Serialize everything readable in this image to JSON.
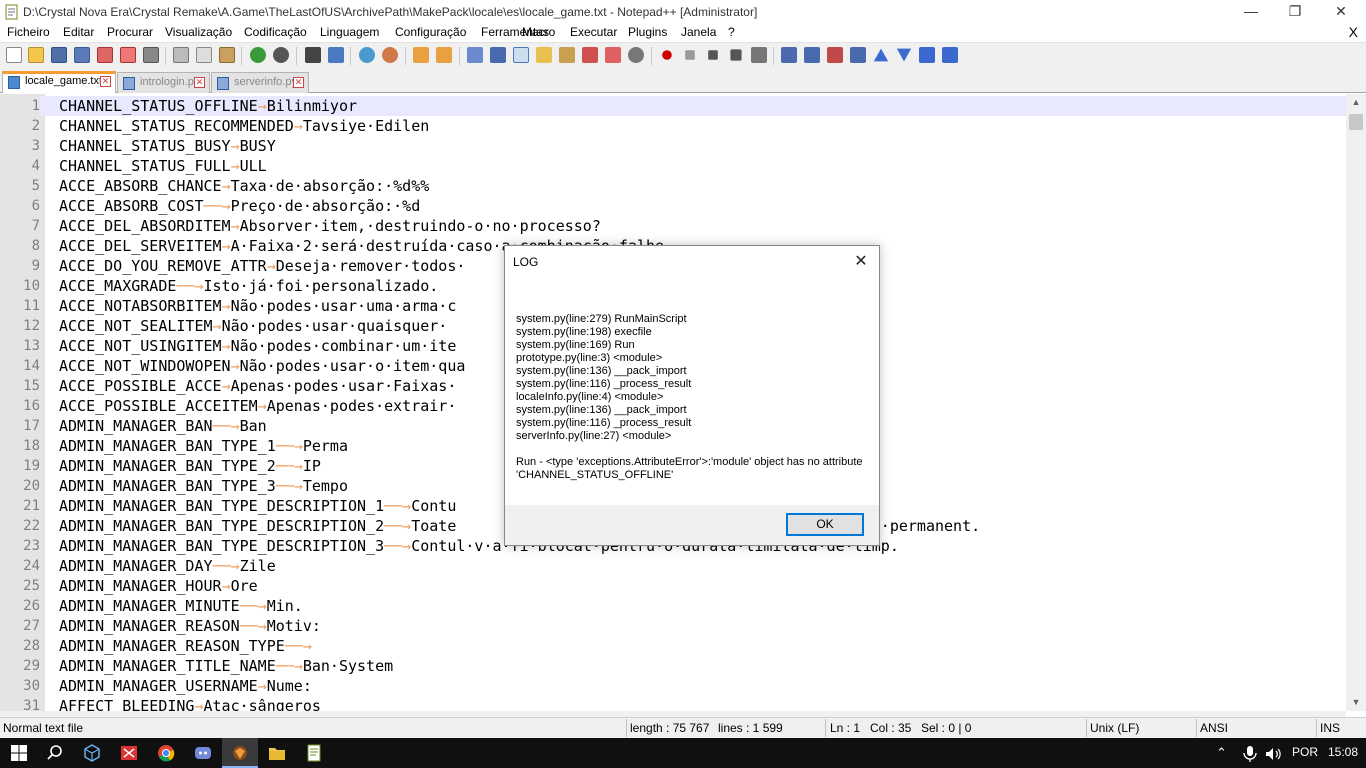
{
  "window": {
    "title": "D:\\Crystal Nova Era\\Crystal Remake\\A.Game\\TheLastOfUS\\ArchivePath\\MakePack\\locale\\es\\locale_game.txt - Notepad++ [Administrator]",
    "minimize": "—",
    "restore": "❐",
    "close": "✕"
  },
  "menu": {
    "items": [
      "Ficheiro",
      "Editar",
      "Procurar",
      "Visualização",
      "Codificação",
      "Linguagem",
      "Configuração",
      "Ferramentas",
      "Macro",
      "Executar",
      "Plugins",
      "Janela",
      "?"
    ],
    "close_doc": "X"
  },
  "tabs": [
    {
      "label": "locale_game.txt",
      "active": true
    },
    {
      "label": "intrologin.py",
      "active": false
    },
    {
      "label": "serverinfo.py",
      "active": false
    }
  ],
  "tab_close_glyph": "✕",
  "editor": {
    "tab_arrow": "→",
    "lines": [
      {
        "n": "1",
        "key": "CHANNEL_STATUS_OFFLINE",
        "pad": "",
        "val": "Bilinmiyor"
      },
      {
        "n": "2",
        "key": "CHANNEL_STATUS_RECOMMENDED",
        "pad": "",
        "val": "Tavsiye·Edilen"
      },
      {
        "n": "3",
        "key": "CHANNEL_STATUS_BUSY",
        "pad": "",
        "val": "BUSY"
      },
      {
        "n": "4",
        "key": "CHANNEL_STATUS_FULL",
        "pad": "",
        "val": "ULL"
      },
      {
        "n": "5",
        "key": "ACCE_ABSORB_CHANCE",
        "pad": "",
        "val": "Taxa·de·absorção:·%d%%"
      },
      {
        "n": "6",
        "key": "ACCE_ABSORB_COST",
        "pad": "──",
        "val": "Preço·de·absorção:·%d"
      },
      {
        "n": "7",
        "key": "ACCE_DEL_ABSORDITEM",
        "pad": "",
        "val": "Absorver·item,·destruindo-o·no·processo?"
      },
      {
        "n": "8",
        "key": "ACCE_DEL_SERVEITEM",
        "pad": "",
        "val": "A·Faixa·2·será·destruída·caso·a·combinação·falhe."
      },
      {
        "n": "9",
        "key": "ACCE_DO_YOU_REMOVE_ATTR",
        "pad": "",
        "val": "Deseja·remover·todos·"
      },
      {
        "n": "10",
        "key": "ACCE_MAXGRADE",
        "pad": "──",
        "val": "Isto·já·foi·personalizado."
      },
      {
        "n": "11",
        "key": "ACCE_NOTABSORBITEM",
        "pad": "",
        "val": "Não·podes·usar·uma·arma·c                                    a."
      },
      {
        "n": "12",
        "key": "ACCE_NOT_SEALITEM",
        "pad": "",
        "val": "Não·podes·usar·quaisquer·"
      },
      {
        "n": "13",
        "key": "ACCE_NOT_USINGITEM",
        "pad": "",
        "val": "Não·podes·combinar·um·ite"
      },
      {
        "n": "14",
        "key": "ACCE_NOT_WINDOWOPEN",
        "pad": "",
        "val": "Não·podes·usar·o·item·qua                                    a."
      },
      {
        "n": "15",
        "key": "ACCE_POSSIBLE_ACCE",
        "pad": "",
        "val": "Apenas·podes·usar·Faixas·"
      },
      {
        "n": "16",
        "key": "ACCE_POSSIBLE_ACCEITEM",
        "pad": "",
        "val": "Apenas·podes·extrair·"
      },
      {
        "n": "17",
        "key": "ADMIN_MANAGER_BAN",
        "pad": "──",
        "val": "Ban"
      },
      {
        "n": "18",
        "key": "ADMIN_MANAGER_BAN_TYPE_1",
        "pad": "──",
        "val": "Perma"
      },
      {
        "n": "19",
        "key": "ADMIN_MANAGER_BAN_TYPE_2",
        "pad": "──",
        "val": "IP"
      },
      {
        "n": "20",
        "key": "ADMIN_MANAGER_BAN_TYPE_3",
        "pad": "──",
        "val": "Tempo"
      },
      {
        "n": "21",
        "key": "ADMIN_MANAGER_BAN_TYPE_DESCRIPTION_1",
        "pad": "──",
        "val": "Contu"
      },
      {
        "n": "22",
        "key": "ADMIN_MANAGER_BAN_TYPE_DESCRIPTION_2",
        "pad": "──",
        "val": "Toate                                           nate·permanent."
      },
      {
        "n": "23",
        "key": "ADMIN_MANAGER_BAN_TYPE_DESCRIPTION_3",
        "pad": "──",
        "val": "Contul·v·a·fi·blocat·pentru·o·durată·limitată·de·timp."
      },
      {
        "n": "24",
        "key": "ADMIN_MANAGER_DAY",
        "pad": "──",
        "val": "Zile"
      },
      {
        "n": "25",
        "key": "ADMIN_MANAGER_HOUR",
        "pad": "",
        "val": "Ore"
      },
      {
        "n": "26",
        "key": "ADMIN_MANAGER_MINUTE",
        "pad": "──",
        "val": "Min."
      },
      {
        "n": "27",
        "key": "ADMIN_MANAGER_REASON",
        "pad": "──",
        "val": "Motiv:"
      },
      {
        "n": "28",
        "key": "ADMIN_MANAGER_REASON_TYPE",
        "pad": "──",
        "val": ""
      },
      {
        "n": "29",
        "key": "ADMIN_MANAGER_TITLE_NAME",
        "pad": "──",
        "val": "Ban·System"
      },
      {
        "n": "30",
        "key": "ADMIN_MANAGER_USERNAME",
        "pad": "",
        "val": "Nume:"
      },
      {
        "n": "31",
        "key": "AFFECT_BLEEDING",
        "pad": "",
        "val": "Atac·sângeros"
      }
    ]
  },
  "dialog": {
    "title": "LOG",
    "close": "✕",
    "trace": [
      "system.py(line:279) RunMainScript",
      "system.py(line:198) execfile",
      "system.py(line:169) Run",
      "prototype.py(line:3) <module>",
      "system.py(line:136) __pack_import",
      "system.py(line:116) _process_result",
      "localeInfo.py(line:4) <module>",
      "system.py(line:136) __pack_import",
      "system.py(line:116) _process_result",
      "serverInfo.py(line:27) <module>"
    ],
    "error": "Run - <type 'exceptions.AttributeError'>:'module' object has no attribute 'CHANNEL_STATUS_OFFLINE'",
    "ok": "OK"
  },
  "status": {
    "filetype": "Normal text file",
    "length": "length : 75 767",
    "lines": "lines : 1 599",
    "ln": "Ln : 1",
    "col": "Col : 35",
    "sel": "Sel : 0 | 0",
    "eol": "Unix (LF)",
    "encoding": "ANSI",
    "mode": "INS"
  },
  "taskbar": {
    "lang": "POR",
    "time": "15:08"
  },
  "colors": {
    "accent_tab": "#fa9b32",
    "tab_arrow": "#f0a060",
    "current_line": "#e8e8ff"
  }
}
